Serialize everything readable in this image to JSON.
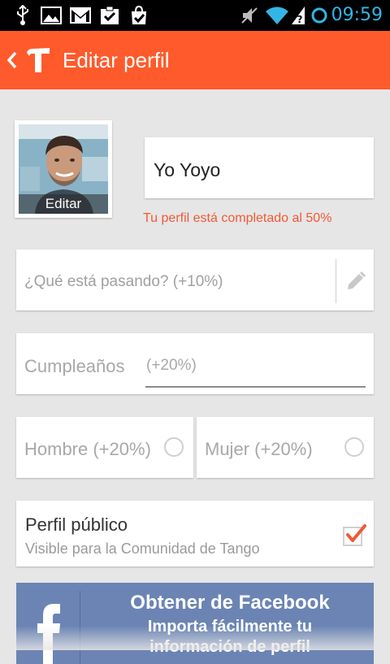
{
  "status_bar": {
    "time": "09:59",
    "icons": [
      "usb-icon",
      "image-icon",
      "gmail-icon",
      "check-clipboard-icon",
      "check-bag-icon",
      "mute-icon",
      "wifi-icon",
      "signal-unknown-icon",
      "sync-ring-icon"
    ]
  },
  "header": {
    "title": "Editar perfil",
    "back_icon": "chevron-left-icon",
    "logo_icon": "tango-logo-icon"
  },
  "profile": {
    "photo_edit_label": "Editar",
    "name": "Yo Yoyo",
    "completion_text": "Tu perfil está completado al 50%"
  },
  "status": {
    "placeholder": "¿Qué está pasando? (+10%)",
    "edit_icon": "pencil-icon"
  },
  "birthday": {
    "label": "Cumpleaños",
    "hint": "(+20%)"
  },
  "gender": {
    "male_label": "Hombre (+20%)",
    "female_label": "Mujer (+20%)",
    "selected": null
  },
  "public_profile": {
    "title": "Perfil público",
    "subtitle": "Visible para la Comunidad de Tango",
    "checked": true
  },
  "facebook": {
    "title": "Obtener de Facebook",
    "subtitle": "Importa fácilmente tu",
    "subtitle_cont": "información de perfil",
    "icon": "facebook-icon"
  },
  "colors": {
    "accent": "#ff5a2b",
    "facebook_blue": "#6b84b3",
    "completion_text": "#ef5a36",
    "clock": "#33b5e5"
  }
}
